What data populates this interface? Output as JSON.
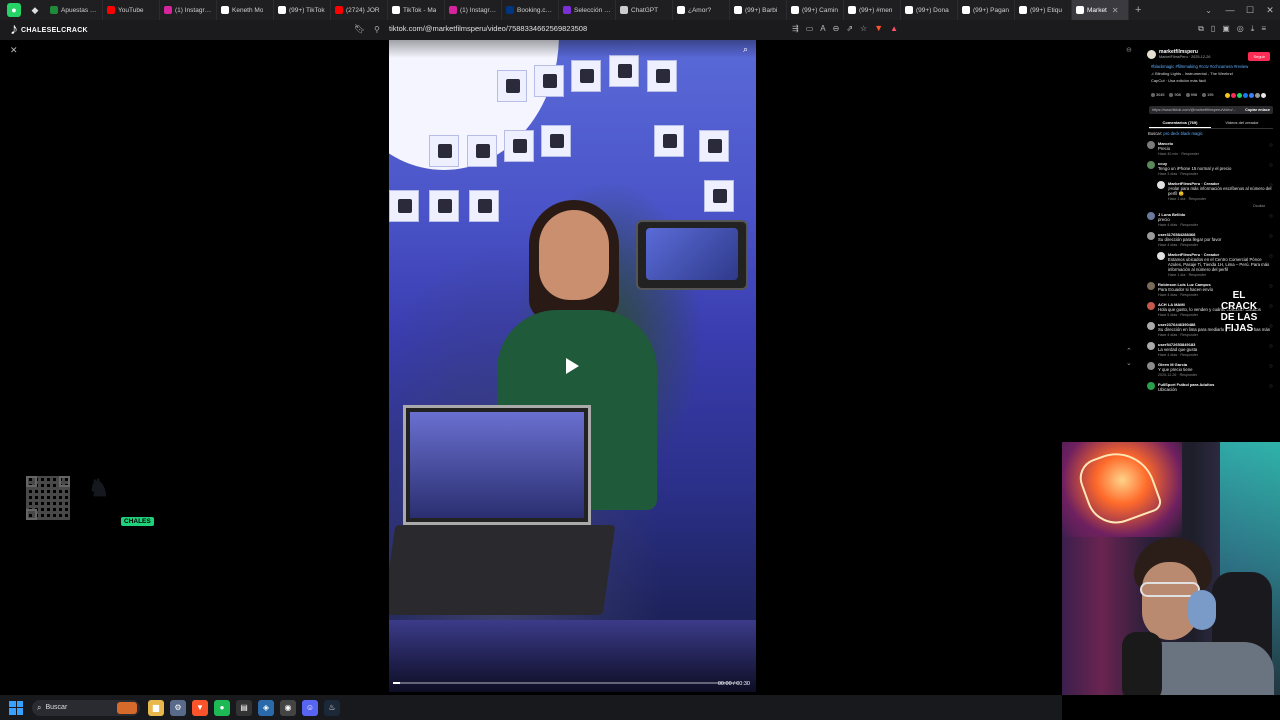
{
  "browser": {
    "tabs": [
      {
        "label": "Apuestas De",
        "color": "#1f8a3a"
      },
      {
        "label": "YouTube",
        "color": "#ff0000"
      },
      {
        "label": "(1) Instagram",
        "color": "#d6249f"
      },
      {
        "label": "Keneth Mo",
        "color": "#ffffff"
      },
      {
        "label": "(99+) TikTok",
        "color": "#ffffff"
      },
      {
        "label": "(2724) JOR",
        "color": "#ff0000"
      },
      {
        "label": "TikTok - Ma",
        "color": "#ffffff"
      },
      {
        "label": "(1) Instagram",
        "color": "#d6249f"
      },
      {
        "label": "Booking.com",
        "color": "#003580"
      },
      {
        "label": "Selección de",
        "color": "#7b2fd6"
      },
      {
        "label": "ChatGPT",
        "color": "#cccccc"
      },
      {
        "label": "¿Amor?",
        "color": "#ffffff"
      },
      {
        "label": "(99+) Barbi",
        "color": "#ffffff"
      },
      {
        "label": "(99+) Camin",
        "color": "#ffffff"
      },
      {
        "label": "(99+) #men",
        "color": "#ffffff"
      },
      {
        "label": "(99+) Dona",
        "color": "#ffffff"
      },
      {
        "label": "(99+) Pagan",
        "color": "#ffffff"
      },
      {
        "label": "(99+) Etiqu",
        "color": "#ffffff"
      },
      {
        "label": "Market",
        "color": "#ffffff"
      }
    ],
    "active_tab_index": 18,
    "url": "tiktok.com/@marketfilmsperu/video/7588334662569823508",
    "new_tab": "+",
    "window_controls": [
      "—",
      "☐",
      "✕"
    ]
  },
  "stream_overlay": {
    "brand": "CHALESELCRACK",
    "badge": "CHALES",
    "crack_logo": [
      "EL",
      "CRACK",
      "DE LAS",
      "FIJAS"
    ]
  },
  "video": {
    "play_icon": "play-icon",
    "progress": 0.02,
    "time": "00:00 / 00:30"
  },
  "panel": {
    "account_name": "marketfilmsperu",
    "account_sub": "MarketFilmsPeru · 2025-12-26",
    "follow_label": "Seguir",
    "description": "#blackmagic #filmmaking #cctv #cchcamera #review",
    "music": "♫ Blinding Lights - Instrumental - The Weeknd",
    "effect": "CapCut · Usa edición más fácil",
    "stats": [
      {
        "value": "3045"
      },
      {
        "value": "908"
      },
      {
        "value": "998"
      },
      {
        "value": "195"
      }
    ],
    "share_colors": [
      "#f7c31d",
      "#fe2c55",
      "#25d366",
      "#1877f2",
      "#3b82f6",
      "#999999",
      "#e5e5e5"
    ],
    "link": "https://www.tiktok.com/@marketfilmsperu/video/…",
    "copy_label": "Copiar enlace",
    "tabs": [
      {
        "label": "Comentarios (769)",
        "active": true
      },
      {
        "label": "Videos del creador",
        "active": false
      }
    ],
    "search_prefix": "Buscar:",
    "search_term": "pro deck black magic",
    "comments": [
      {
        "user": "Marcelo",
        "text": "Precio",
        "meta": "Hace 40 min · Responder",
        "reply": false,
        "avatar": "#7a7a7a"
      },
      {
        "user": "ccuy",
        "text": "Tengo un iPhone 15 normal y el precio",
        "meta": "Hace 3 días · Responder",
        "reply": false,
        "avatar": "#5a8a5a"
      },
      {
        "user": "MarketFilmsPeru · Creador",
        "text": "¡Hola! para más información escríbenos al número del perfil 😊",
        "meta": "Hace 1 día · Responder",
        "reply": true,
        "avatar": "#e0e0e0"
      },
      {
        "user": "J Luna Bellido",
        "text": "precio",
        "meta": "Hace 4 días · Responder",
        "reply": false,
        "avatar": "#6a7a9a"
      },
      {
        "user": "user3176584288368",
        "text": "Su dirección para llegar por favor",
        "meta": "Hace 4 días · Responder",
        "reply": false,
        "avatar": "#9a9a9a"
      },
      {
        "user": "MarketFilmsPeru · Creador",
        "text": "Estamos ubicados en el Centro Comercial Pónce Azules, Pasaje Ti, Tienda 1H, Lima – Perú. Para más información al número del perfil",
        "meta": "Hace 1 día · Responder",
        "reply": true,
        "avatar": "#e0e0e0"
      },
      {
        "user": "Robinson Luis Luz Campos",
        "text": "Para Ecuador si hacen envío",
        "meta": "Hace 4 días · Responder",
        "reply": false,
        "avatar": "#7a6a5a"
      },
      {
        "user": "ACH LA MAMI",
        "text": "Hola que gusto, lo venden y cuánto costaría? Saludos",
        "meta": "Hace 5 días · Responder",
        "reply": false,
        "avatar": "#c45a4a"
      },
      {
        "user": "user2376446390488",
        "text": "Su dirección en lima para mediarlo y comprar muchas más",
        "meta": "Hace 4 días · Responder",
        "reply": false,
        "avatar": "#aaaaaa"
      },
      {
        "user": "user5472653849183",
        "text": "La verdad que gusta",
        "meta": "Hace 4 días · Responder",
        "reply": false,
        "avatar": "#aaaaaa"
      },
      {
        "user": "Gleen M Garcia",
        "text": "Y que precio tiene",
        "meta": "2025-12-26 · Responder",
        "reply": false,
        "avatar": "#8a8a8a"
      },
      {
        "user": "FullSport Futbol para Adultos",
        "text": "Ubicación",
        "meta": "",
        "reply": false,
        "avatar": "#2aa04a"
      }
    ],
    "hide_label": "Ocultar"
  },
  "taskbar": {
    "search_placeholder": "Buscar",
    "apps": [
      {
        "icon": "file-explorer-icon",
        "color": "#e8b84a",
        "glyph": "▆"
      },
      {
        "icon": "settings-icon",
        "color": "#5a6a8a",
        "glyph": "⚙"
      },
      {
        "icon": "brave-icon",
        "color": "#fb542b",
        "glyph": "▼"
      },
      {
        "icon": "spotify-icon",
        "color": "#1db954",
        "glyph": "●"
      },
      {
        "icon": "elgato-icon",
        "color": "#333333",
        "glyph": "▤"
      },
      {
        "icon": "vpn-icon",
        "color": "#2a6aaa",
        "glyph": "◈"
      },
      {
        "icon": "obs-icon",
        "color": "#444444",
        "glyph": "◉"
      },
      {
        "icon": "discord-icon",
        "color": "#5865f2",
        "glyph": "☺"
      },
      {
        "icon": "steam-icon",
        "color": "#1b2838",
        "glyph": "♨"
      }
    ]
  }
}
